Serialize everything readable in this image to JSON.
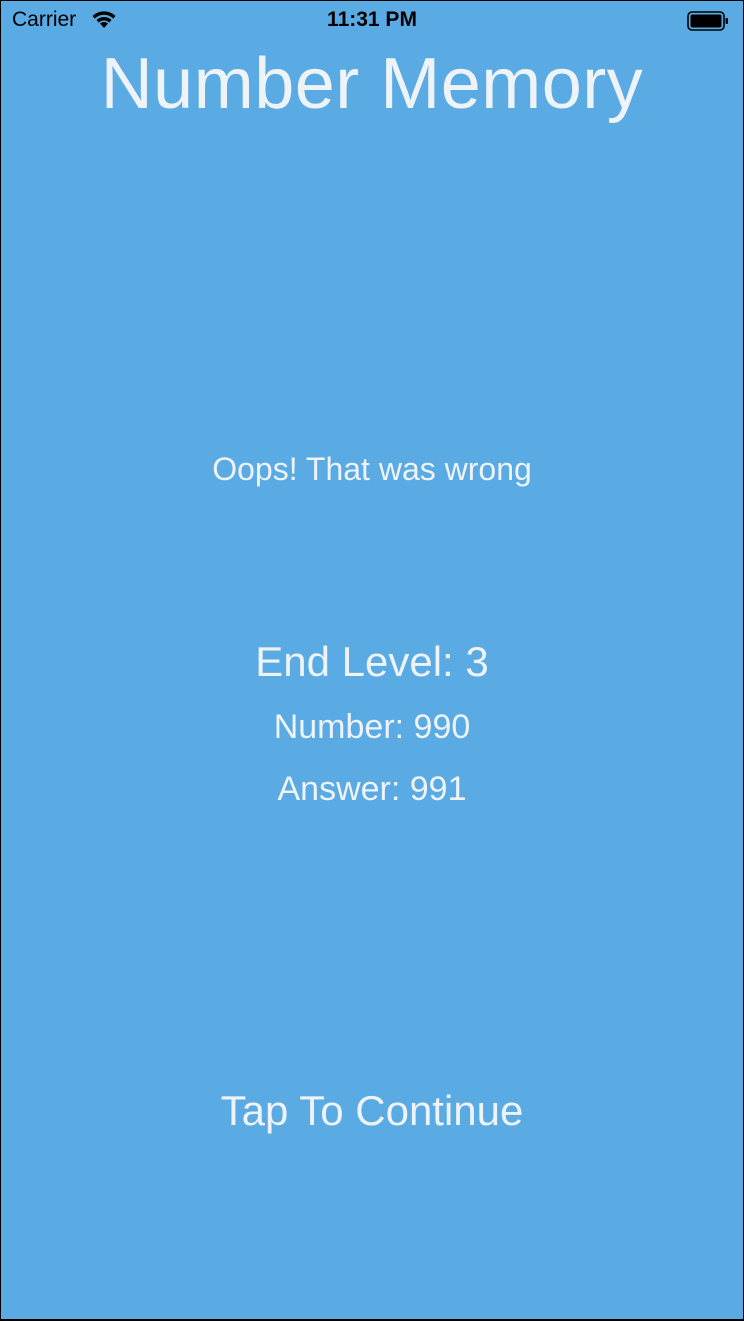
{
  "status_bar": {
    "carrier": "Carrier",
    "time": "11:31 PM",
    "wifi_icon": "wifi-icon",
    "battery_icon": "battery-icon",
    "battery_level": 1.0
  },
  "app": {
    "title": "Number Memory",
    "background_color": "#5aaae4",
    "text_color": "#eef3f8"
  },
  "result": {
    "message": "Oops! That was wrong",
    "level_label": "End Level: ",
    "level_value": "3",
    "number_label": "Number: ",
    "number_value": "990",
    "answer_label": "Answer: ",
    "answer_value": "991"
  },
  "actions": {
    "continue_label": "Tap To Continue"
  }
}
